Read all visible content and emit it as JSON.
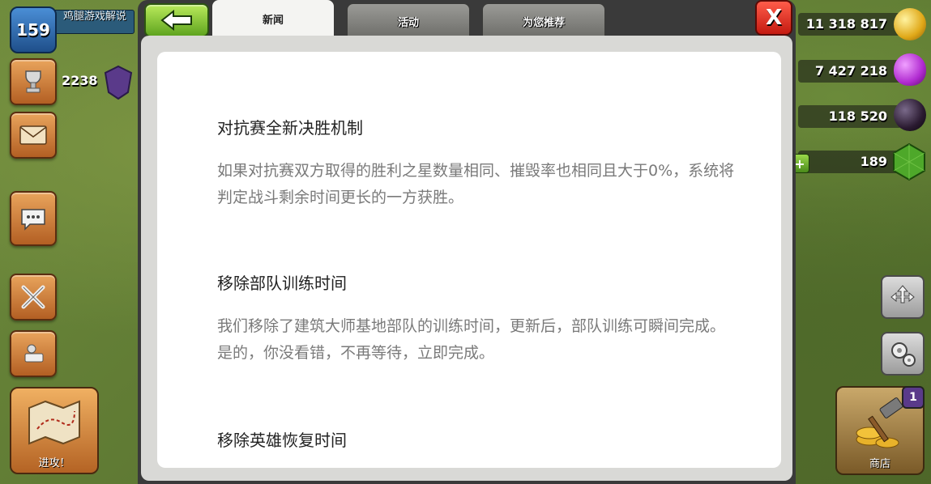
{
  "player": {
    "level": "159",
    "name": "鸡腿游戏解说",
    "trophies": "2238"
  },
  "resources": {
    "gold": "11 318 817",
    "elixir": "7 427 218",
    "dark_elixir": "118 520",
    "gems": "189"
  },
  "dialog": {
    "tabs": [
      {
        "label": "新闻",
        "active": true
      },
      {
        "label": "活动",
        "active": false
      },
      {
        "label": "为您推荐",
        "active": false
      }
    ],
    "close_label": "X",
    "articles": [
      {
        "title": "对抗赛全新决胜机制",
        "body": "如果对抗赛双方取得的胜利之星数量相同、摧毁率也相同且大于0%，系统将判定战斗剩余时间更长的一方获胜。"
      },
      {
        "title": "移除部队训练时间",
        "body": "我们移除了建筑大师基地部队的训练时间，更新后，部队训练可瞬间完成。是的，你没看错，不再等待，立即完成。"
      },
      {
        "title": "移除英雄恢复时间",
        "body": ""
      }
    ]
  },
  "buttons": {
    "attack_label": "进攻！",
    "shop_label": "商店",
    "shop_badge": "1"
  }
}
